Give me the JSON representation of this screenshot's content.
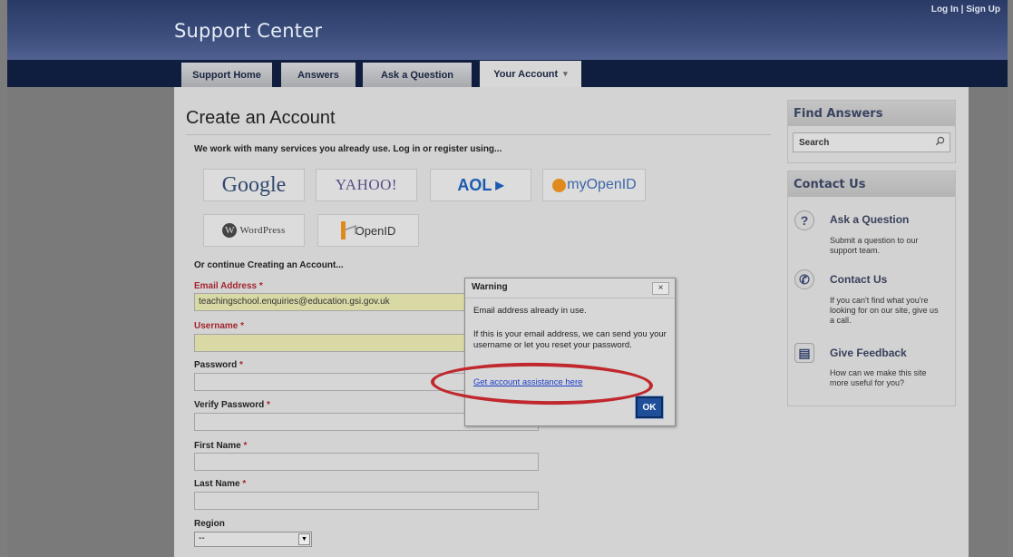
{
  "header": {
    "brand": "Support Center",
    "login": "Log In",
    "separator": "|",
    "signup": "Sign Up"
  },
  "nav": {
    "tabs": [
      {
        "label": "Support Home"
      },
      {
        "label": "Answers"
      },
      {
        "label": "Ask a Question"
      },
      {
        "label": "Your Account",
        "active": true,
        "caret": "▾"
      }
    ]
  },
  "main": {
    "title": "Create an Account",
    "intro": "We work with many services you already use. Log in or register using...",
    "providers": [
      "Google",
      "YAHOO!",
      "AOL",
      "myOpenID",
      "WordPress",
      "OpenID"
    ],
    "section_label": "Or continue Creating an Account...",
    "form": {
      "email_label": "Email Address",
      "email_value": "teachingschool.enquiries@education.gsi.gov.uk",
      "username_label": "Username",
      "password_label": "Password",
      "verify_label": "Verify Password",
      "first_label": "First Name",
      "last_label": "Last Name",
      "region_label": "Region",
      "region_value": "--",
      "required_marker": "*"
    }
  },
  "sidebar": {
    "find_title": "Find Answers",
    "search_placeholder": "Search",
    "contact_title": "Contact Us",
    "items": [
      {
        "title": "Ask a Question",
        "desc": "Submit a question to our support team.",
        "icon": "question-icon"
      },
      {
        "title": "Contact Us",
        "desc": "If you can't find what you're looking for on our site, give us a call.",
        "icon": "phone-icon"
      },
      {
        "title": "Give Feedback",
        "desc": "How can we make this site more useful for you?",
        "icon": "feedback-icon"
      }
    ]
  },
  "modal": {
    "title": "Warning",
    "close": "×",
    "message": "Email address already in use.",
    "detail": "If this is your email address, we can send you your username or let you reset your password.",
    "link": "Get account assistance here",
    "ok": "OK"
  },
  "colors": {
    "header": "#2a3a66",
    "navbar": "#0f1d3e",
    "required": "#a3262e",
    "highlight_field": "#d9d9a6",
    "link": "#1a3cc9",
    "annotation": "#c0282d"
  }
}
